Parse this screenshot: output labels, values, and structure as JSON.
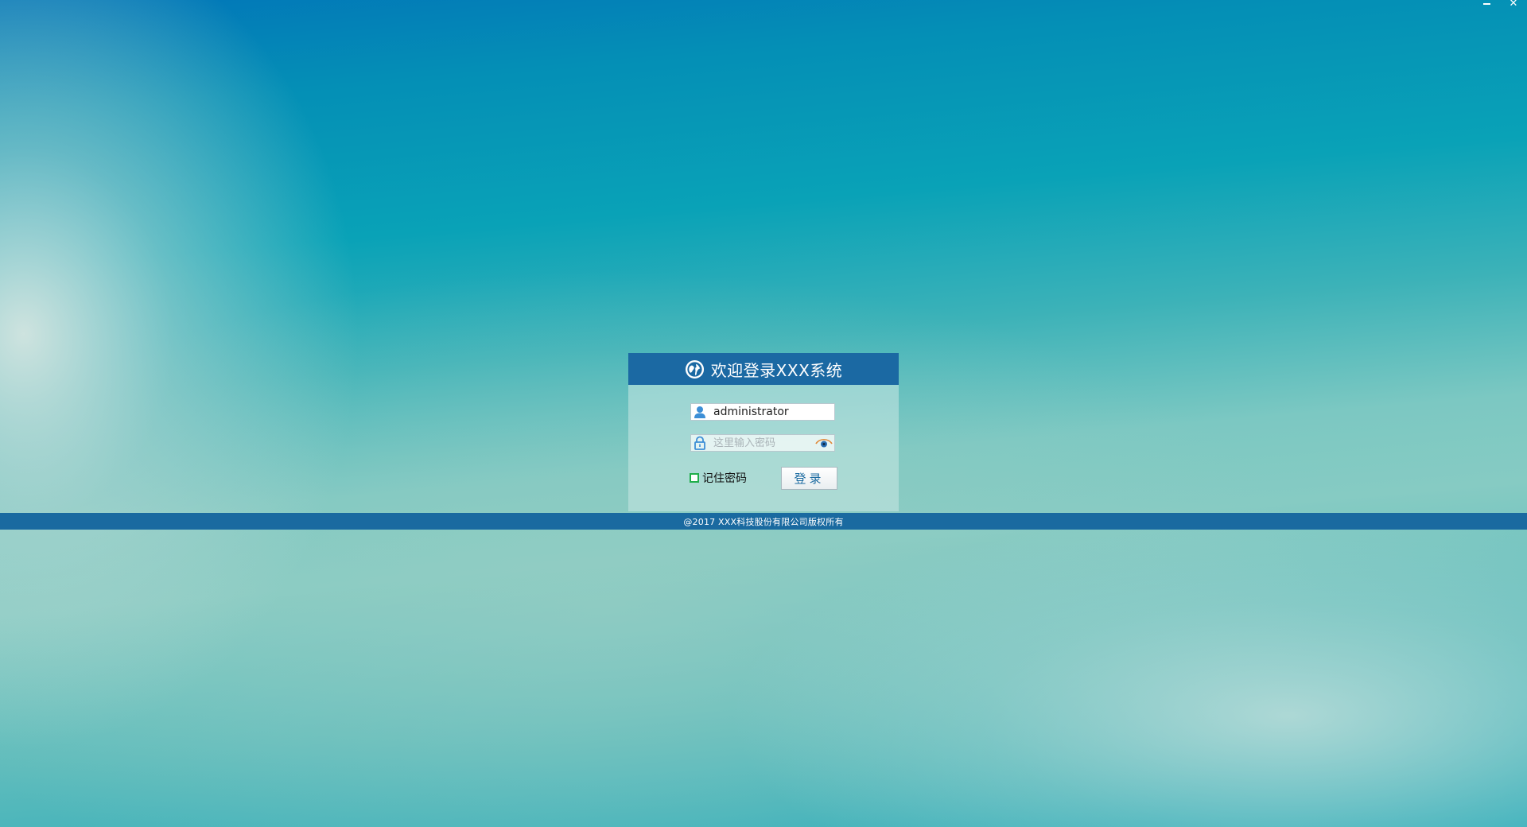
{
  "window": {
    "minimize_icon": "minimize-icon",
    "close_icon": "close-icon",
    "close_glyph": "✕"
  },
  "login": {
    "title": "欢迎登录XXX系统",
    "logo_icon": "globe-icon",
    "username": {
      "value": "administrator",
      "icon": "user-icon"
    },
    "password": {
      "placeholder": "这里输入密码",
      "value": "",
      "icon": "lock-icon",
      "toggle_icon": "eye-icon"
    },
    "remember": {
      "label": "记住密码",
      "checked": false
    },
    "submit_label": "登录"
  },
  "footer": {
    "copyright": "@2017 XXX科技股份有限公司版权所有"
  },
  "colors": {
    "header": "#1b69a3",
    "footer_band": "#1a6aa0",
    "checkbox_border": "#1fae4a"
  }
}
